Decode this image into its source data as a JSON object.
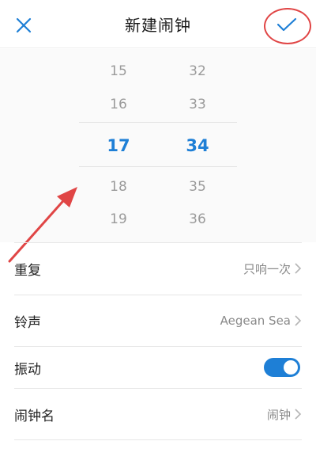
{
  "header": {
    "title": "新建闹钟",
    "close_icon": "close-icon",
    "confirm_icon": "check-icon"
  },
  "picker": {
    "hours": [
      "15",
      "16",
      "17",
      "18",
      "19"
    ],
    "minutes": [
      "32",
      "33",
      "34",
      "35",
      "36"
    ],
    "selected_hour": "17",
    "selected_minute": "34"
  },
  "settings": {
    "repeat": {
      "label": "重复",
      "value": "只响一次"
    },
    "ringtone": {
      "label": "铃声",
      "value": "Aegean Sea"
    },
    "vibrate": {
      "label": "振动",
      "enabled": true
    },
    "alarm_name": {
      "label": "闹钟名",
      "value": "闹钟"
    }
  },
  "colors": {
    "accent": "#1e7fd6",
    "annotation": "#e04545"
  }
}
